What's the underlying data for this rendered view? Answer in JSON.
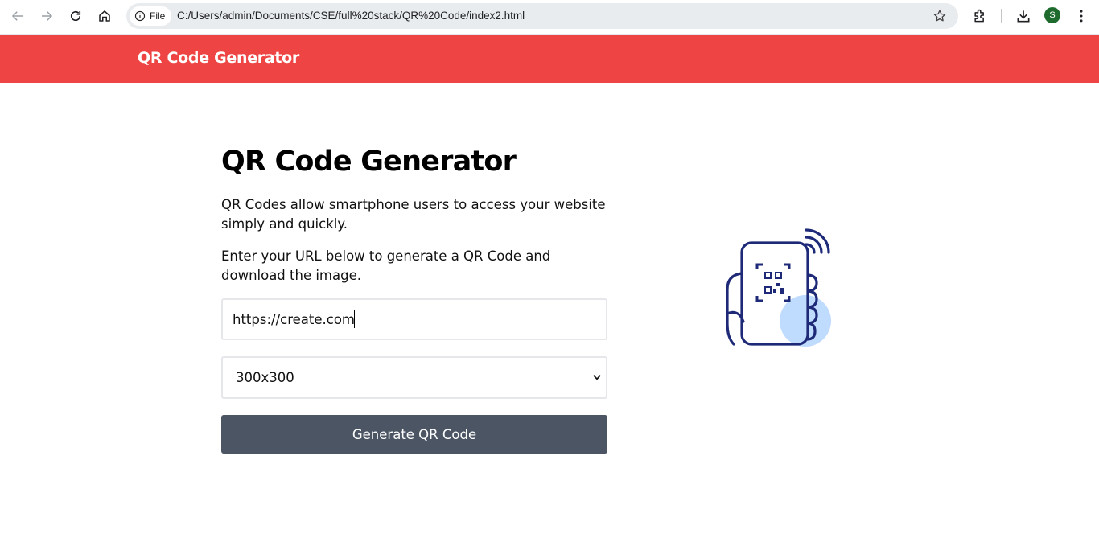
{
  "browser": {
    "site_chip_label": "File",
    "url": "C:/Users/admin/Documents/CSE/full%20stack/QR%20Code/index2.html",
    "profile_initial": "S"
  },
  "header": {
    "brand": "QR Code Generator"
  },
  "main": {
    "title": "QR Code Generator",
    "description_1": "QR Codes allow smartphone users to access your website simply and quickly.",
    "description_2": "Enter your URL below to generate a QR Code and download the image.",
    "url_input_value": "https://create.com",
    "size_select_value": "300x300",
    "generate_button_label": "Generate QR Code"
  },
  "colors": {
    "header_bg": "#ef4444",
    "button_bg": "#4b5563",
    "illustration_stroke": "#1e2a78",
    "illustration_accent": "#bfdbfe"
  },
  "icons": {
    "back": "arrow-left-icon",
    "forward": "arrow-right-icon",
    "reload": "reload-icon",
    "home": "home-icon",
    "info": "info-icon",
    "bookmark": "star-icon",
    "extensions": "puzzle-icon",
    "downloads": "download-icon",
    "menu": "more-vertical-icon",
    "select_chevron": "chevron-down-icon"
  }
}
